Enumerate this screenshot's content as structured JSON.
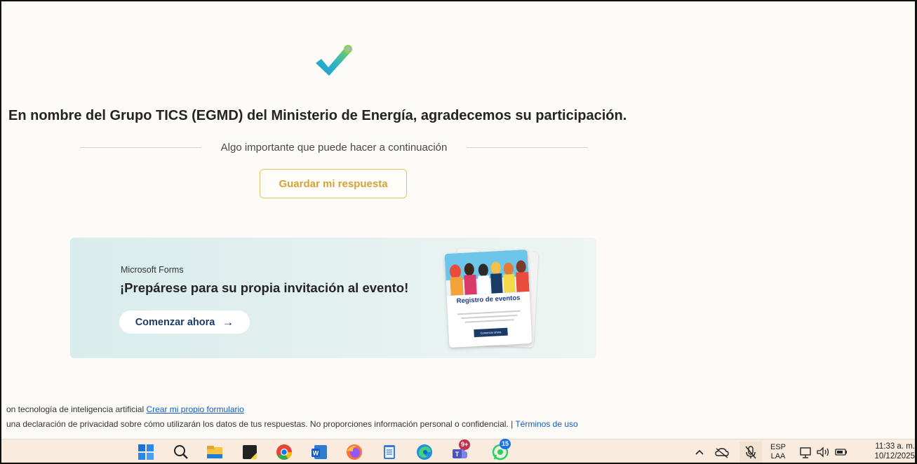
{
  "thank_you": {
    "message": "En nombre del Grupo TICS (EGMD) del Ministerio de Energía, agradecemos su participación."
  },
  "next_step": {
    "divider_text": "Algo importante que puede hacer a continuación",
    "save_button": "Guardar mi respuesta"
  },
  "promo": {
    "brand": "Microsoft Forms",
    "headline": "¡Prepárese para su propia invitación al evento!",
    "cta_label": "Comenzar ahora",
    "cta_arrow": "→",
    "card_title": "Registro de eventos",
    "card_button": "Comenzar ahora"
  },
  "footer": {
    "line1_text": "on tecnología de inteligencia artificial",
    "create_link": "Crear mi propio formulario",
    "line2_text": "una declaración de privacidad sobre cómo utilizarán los datos de tus respuestas. No proporciones información personal o confidencial. |",
    "terms_link": "Términos de uso"
  },
  "taskbar": {
    "apps": [
      "start-icon",
      "search-icon",
      "file-explorer-icon",
      "sticky-notes-icon",
      "chrome-icon",
      "word-icon",
      "firefox-icon",
      "notepad-icon",
      "edge-icon",
      "teams-icon",
      "whatsapp-icon"
    ],
    "teams_badge": "9+",
    "whatsapp_badge": "15",
    "language_top": "ESP",
    "language_bottom": "LAA",
    "time": "11:33 a. m.",
    "date": "10/12/2025"
  },
  "colors": {
    "accent_gold": "#d4a23a",
    "link_blue": "#0f5cc0",
    "promo_bg": "#dcedec",
    "taskbar_bg": "#f9ecdf"
  }
}
